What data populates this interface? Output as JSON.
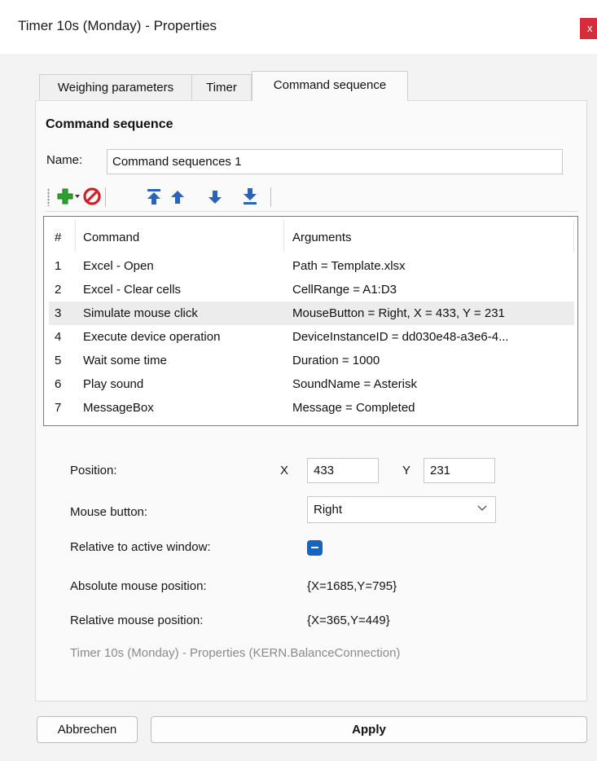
{
  "window": {
    "title": "Timer 10s (Monday) - Properties",
    "close_glyph": "x"
  },
  "tabs": [
    {
      "label": "Weighing parameters",
      "active": false
    },
    {
      "label": "Timer",
      "active": false
    },
    {
      "label": "Command sequence",
      "active": true
    }
  ],
  "section": {
    "title": "Command sequence"
  },
  "name_field": {
    "label": "Name:",
    "value": "Command sequences 1"
  },
  "toolbar": {
    "icons": [
      "add-icon",
      "dropdown-arrow-icon",
      "delete-icon",
      "move-top-icon",
      "move-up-icon",
      "move-down-icon",
      "move-bottom-icon"
    ],
    "colors": {
      "add": "#2e9e2e",
      "delete": "#d0202a",
      "move": "#2b63b8"
    }
  },
  "commands": {
    "headers": {
      "num": "#",
      "command": "Command",
      "arguments": "Arguments"
    },
    "rows": [
      {
        "num": "1",
        "command": "Excel - Open",
        "arguments": "Path = Template.xlsx"
      },
      {
        "num": "2",
        "command": "Excel - Clear cells",
        "arguments": "CellRange = A1:D3"
      },
      {
        "num": "3",
        "command": "Simulate mouse click",
        "arguments": "MouseButton = Right, X = 433, Y = 231"
      },
      {
        "num": "4",
        "command": "Execute device operation",
        "arguments": "DeviceInstanceID = dd030e48-a3e6-4..."
      },
      {
        "num": "5",
        "command": "Wait some time",
        "arguments": "Duration = 1000"
      },
      {
        "num": "6",
        "command": "Play sound",
        "arguments": "SoundName = Asterisk"
      },
      {
        "num": "7",
        "command": "MessageBox",
        "arguments": "Message = Completed"
      }
    ],
    "selected_row": "3"
  },
  "properties": {
    "position_label": "Position:",
    "x_label": "X",
    "x_value": "433",
    "y_label": "Y",
    "y_value": "231",
    "mouse_button_label": "Mouse button:",
    "mouse_button_value": "Right",
    "relative_label": "Relative to active window:",
    "relative_checked": true,
    "absolute_label": "Absolute mouse position:",
    "absolute_value": "{X=1685,Y=795}",
    "relative_pos_label": "Relative mouse position:",
    "relative_pos_value": "{X=365,Y=449}",
    "note": "Timer 10s (Monday) - Properties (KERN.BalanceConnection)"
  },
  "buttons": {
    "cancel": "Abbrechen",
    "apply": "Apply"
  },
  "colors": {
    "accent": "#1565c0",
    "close": "#d72c3a",
    "selection": "#ececec"
  }
}
